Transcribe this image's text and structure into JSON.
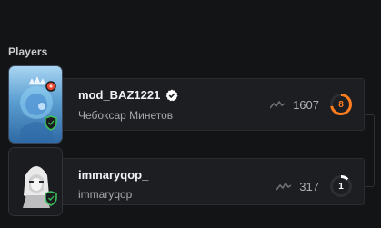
{
  "section": {
    "title": "Players"
  },
  "players": [
    {
      "name": "mod_BAZ1221",
      "subtitle": "Чебоксар Минетов",
      "rating": "1607",
      "level": "8",
      "level_progress": 0.72,
      "verified": true,
      "level_color": "#ff7d1f",
      "icons": [
        "crown-icon",
        "red-badge-icon",
        "shield-icon",
        "verified-icon",
        "trend-icon"
      ]
    },
    {
      "name": "immaryqop_",
      "subtitle": "immaryqop",
      "rating": "317",
      "level": "1",
      "level_progress": 0.12,
      "verified": false,
      "level_color": "#ffffff",
      "icons": [
        "shield-icon",
        "trend-icon"
      ]
    }
  ],
  "colors": {
    "background": "#131416",
    "card": "#1d1e21",
    "accent": "#ff7d1f",
    "shield": "#3bbf5a"
  }
}
